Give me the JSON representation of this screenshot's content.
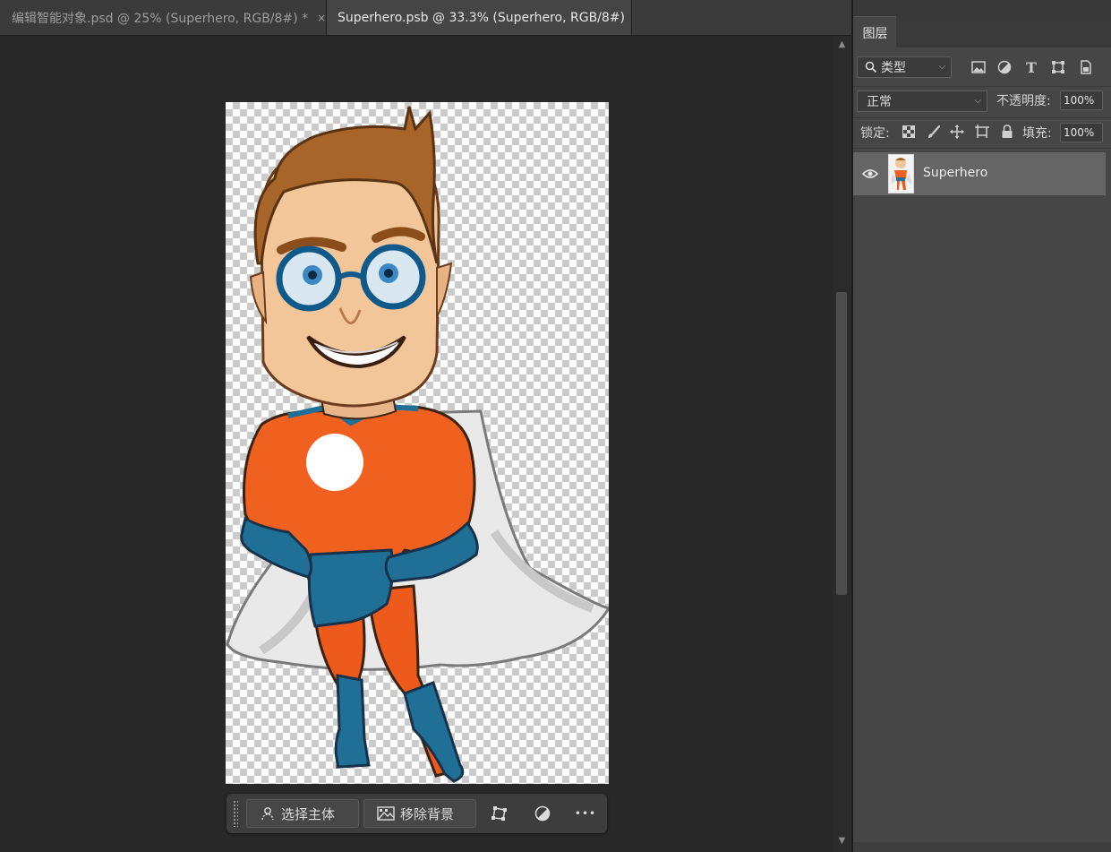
{
  "tabs": [
    {
      "label": "编辑智能对象.psd @ 25% (Superhero, RGB/8#) *",
      "active": false
    },
    {
      "label": "Superhero.psb @ 33.3% (Superhero, RGB/8#)",
      "active": true
    }
  ],
  "tab_close_glyph": "×",
  "canvas": {
    "checker_colors": [
      "#ffffff",
      "#cccccc"
    ],
    "artwork": "superhero-illustration"
  },
  "taskbar": {
    "select_subject_label": "选择主体",
    "remove_background_label": "移除背景",
    "icons": [
      "transform-icon",
      "adjustment-icon",
      "more-icon"
    ],
    "more_glyph": "•••"
  },
  "layers_panel": {
    "tab_label": "图层",
    "filter": {
      "value": "类型",
      "icons": [
        "image-filter-icon",
        "adjustment-filter-icon",
        "type-filter-icon",
        "shape-filter-icon",
        "smart-object-filter-icon"
      ]
    },
    "blend_mode": "正常",
    "opacity_label": "不透明度:",
    "opacity_value": "100%",
    "lock_label": "锁定:",
    "lock_icons": [
      "lock-transparent-icon",
      "lock-pixels-icon",
      "lock-position-icon",
      "lock-artboard-icon",
      "lock-all-icon"
    ],
    "fill_label": "填充:",
    "fill_value": "100%",
    "layers": [
      {
        "name": "Superhero",
        "visible": true,
        "selected": true
      }
    ]
  },
  "colors": {
    "panel_bg": "#464646",
    "selected_layer": "#656565",
    "workspace_bg": "#282828",
    "tab_bar": "#3b3b3b"
  }
}
